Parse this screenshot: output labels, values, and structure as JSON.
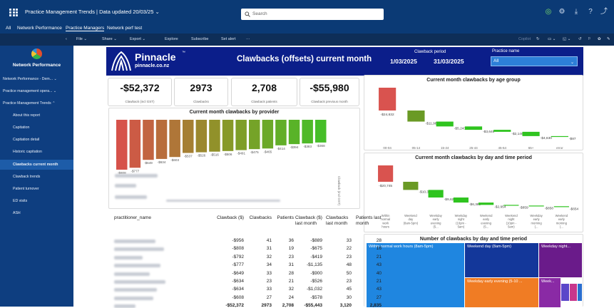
{
  "topbar": {
    "app_title": "Practice Management Trends  |  Data updated 20/03/25  ⌄",
    "search_placeholder": "Search"
  },
  "nav_tabs": [
    "All",
    "Network Performance",
    "Practice Managers",
    "Network perf test"
  ],
  "commands": [
    "‹",
    "File ⌄",
    "Share ⌄",
    "Export ⌄",
    "Explore",
    "Subscribe",
    "Set alert",
    "···",
    "Copilot"
  ],
  "sidebar": {
    "workspace": "Network Performance",
    "items": [
      "Network Performance - Dem... ⌄",
      "Practice management opera... ⌄",
      "Practice Management Trends ⌃",
      "About this report",
      "Capitation",
      "Capitation detail",
      "Historic capitation",
      "Clawbacks current month",
      "Clawback trends",
      "Patient turnover",
      "ED visits",
      "ASH"
    ]
  },
  "banner": {
    "logo": "Pinnacle",
    "logo_tm": "™",
    "logo_url": "pinnacle.co.nz",
    "title": "Clawbacks (offsets) current month",
    "period_label": "Clawback period",
    "period_from": "1/03/2025",
    "period_to": "31/03/2025",
    "practice_label": "Practice name",
    "practice_value": "All"
  },
  "kpis": [
    {
      "value": "-$52,372",
      "label": "Clawback (incl GST)"
    },
    {
      "value": "2973",
      "label": "Clawbacks"
    },
    {
      "value": "2,708",
      "label": "Clawback patients"
    },
    {
      "value": "-$55,980",
      "label": "Clawback previous month"
    }
  ],
  "provider_chart": {
    "title": "Current month clawbacks by provider",
    "values": [
      -808,
      -777,
      -649,
      -634,
      -603,
      -537,
      -526,
      -516,
      -506,
      -491,
      -475,
      -465,
      -414,
      -394,
      -383,
      -368
    ],
    "labels": [
      "-$808",
      "-$777",
      "-$649",
      "-$634",
      "-$603",
      "-$537",
      "-$526",
      "-$516",
      "-$506",
      "-$491",
      "-$475",
      "-$465",
      "-$414",
      "-$394",
      "-$383",
      "-$368"
    ],
    "side_axis": "Clawback (incl GST)"
  },
  "table": {
    "headers": [
      "practitioner_name",
      "Clawback ($)",
      "Clawbacks",
      "Patients",
      "Clawback ($) last month",
      "Clawbacks last month",
      "Patients last month"
    ],
    "rows": [
      [
        "-$956",
        "41",
        "36",
        "-$889",
        "33",
        "28"
      ],
      [
        "-$808",
        "31",
        "19",
        "-$675",
        "22",
        "16"
      ],
      [
        "-$792",
        "32",
        "23",
        "-$419",
        "23",
        "21"
      ],
      [
        "-$777",
        "34",
        "31",
        "-$1,135",
        "48",
        "43"
      ],
      [
        "-$649",
        "33",
        "28",
        "-$900",
        "50",
        "40"
      ],
      [
        "-$634",
        "23",
        "21",
        "-$526",
        "23",
        "21"
      ],
      [
        "-$634",
        "33",
        "32",
        "-$1,032",
        "45",
        "43"
      ],
      [
        "-$608",
        "27",
        "24",
        "-$578",
        "30",
        "27"
      ]
    ],
    "total": [
      "-$52,372",
      "2973",
      "2,708",
      "-$55,443",
      "3,120",
      "2,835"
    ]
  },
  "chart_data": [
    {
      "type": "waterfall",
      "title": "Current month clawbacks by age group",
      "categories": [
        "00-04",
        "05-14",
        "15-24",
        "25-44",
        "45-64",
        "65+",
        "error"
      ],
      "values": [
        -24632,
        -11965,
        -5243,
        -3649,
        -2146,
        -4630,
        -87
      ],
      "labels": [
        "-$24,632",
        "-$11,965",
        "-$5,243",
        "-$3,649",
        "-$2,146",
        "-$4,630",
        "-$87"
      ]
    },
    {
      "type": "waterfall",
      "title": "Current month clawbacks by day and time period",
      "categories": [
        "Within normal work hours (8a...",
        "Weekend day (8am-5pm)",
        "Weekday early evening (5...",
        "Weekday night (10pm - 5am)",
        "Weekend early evening (5...",
        "Weekend night (10pm - 5am)",
        "Weekday early morning (...",
        "Weekend early morning (..."
      ],
      "values": [
        -20745,
        -10309,
        -9624,
        -6389,
        -2954,
        -859,
        -858,
        -654
      ],
      "labels": [
        "-$20,745",
        "-$10,309",
        "-$9,624",
        "-$6,389",
        "-$2,954",
        "-$859",
        "-$858",
        "-$654"
      ]
    }
  ],
  "treemap": {
    "title": "Number of clawbacks by day and time period",
    "tiles": [
      "Within normal work hours (8am-5pm)",
      "Weekend day (8am-5pm)",
      "Weekday night...",
      "Weekday early evening (5-10 ...",
      "Week..."
    ],
    "colors": [
      "#1f86e0",
      "#13379a",
      "#6a1b8a",
      "#f07c24",
      "#8a2aa5",
      "#5b46c9",
      "#c8378c",
      "#2a6fd0"
    ]
  }
}
